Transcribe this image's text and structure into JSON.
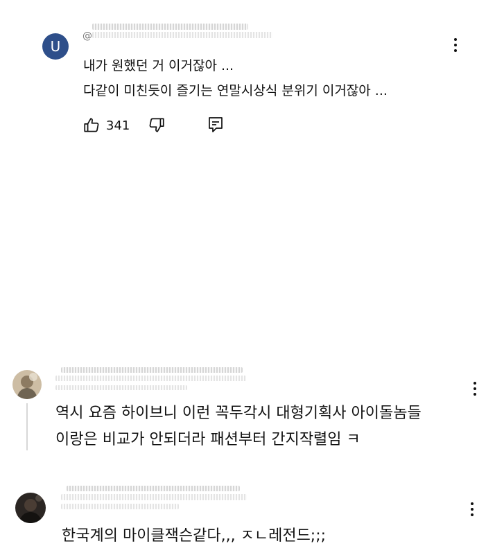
{
  "comments": [
    {
      "avatar_letter": "U",
      "avatar_color": "#2e4f8a",
      "handle_prefix": "@",
      "lines": [
        "내가 원했던 거 이거잖아 ...",
        "다같이 미친듯이 즐기는 연말시상식 분위기 이거잖아 ..."
      ],
      "like_count": "341"
    },
    {
      "lines": [
        "역시 요즘 하이브니 이런 꼭두각시 대형기획사 아이돌놈들",
        "이랑은 비교가 안되더라 패션부터 간지작렬임 ㅋ"
      ]
    },
    {
      "lines": [
        "한국계의 마이클잭슨같다,,, ㅈㄴ레전드;;;"
      ]
    }
  ],
  "icons": {
    "like": "thumbs-up-icon",
    "dislike": "thumbs-down-icon",
    "reply": "reply-icon",
    "more": "more-vertical-icon"
  }
}
